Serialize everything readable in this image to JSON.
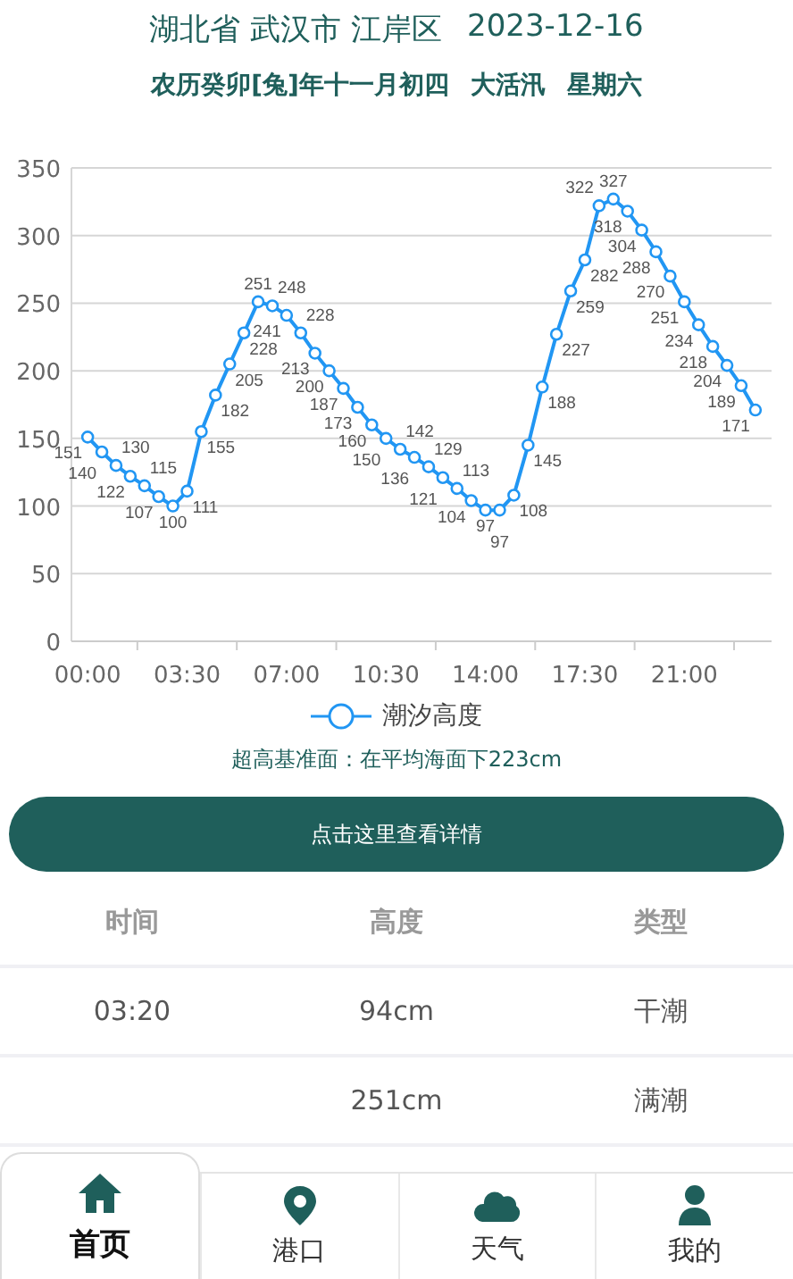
{
  "header": {
    "location": "湖北省 武汉市 江岸区",
    "date": "2023-12-16"
  },
  "lunar": [
    "农历癸卯[兔]年十一月初四",
    "大活汛",
    "星期六"
  ],
  "chart_data": {
    "type": "line",
    "x": [
      0,
      0.5,
      1,
      1.5,
      2,
      2.5,
      3,
      3.5,
      4,
      4.5,
      5,
      5.5,
      6,
      6.5,
      7,
      7.5,
      8,
      8.5,
      9,
      9.5,
      10,
      10.5,
      11,
      11.5,
      12,
      12.5,
      13,
      13.5,
      14,
      14.5,
      15,
      15.5,
      16,
      16.5,
      17,
      17.5,
      18,
      18.5,
      19,
      19.5,
      20,
      20.5,
      21,
      21.5,
      22,
      22.5,
      23,
      23.5
    ],
    "series": [
      {
        "name": "潮汐高度",
        "color": "#2196f3",
        "marker": "circle",
        "values": [
          151,
          140,
          130,
          122,
          115,
          107,
          100,
          111,
          155,
          182,
          205,
          228,
          251,
          248,
          241,
          228,
          213,
          200,
          187,
          173,
          160,
          150,
          142,
          136,
          129,
          121,
          113,
          104,
          97,
          97,
          108,
          145,
          188,
          227,
          259,
          282,
          322,
          327,
          318,
          304,
          288,
          270,
          251,
          234,
          218,
          204,
          189,
          171
        ]
      }
    ],
    "xlim": [
      -0.57,
      24.07
    ],
    "ylim": [
      0,
      350
    ],
    "yticks": [
      0,
      50,
      100,
      150,
      200,
      250,
      300,
      350
    ],
    "xticks": [
      {
        "value": 0,
        "label": "00:00"
      },
      {
        "value": 3.5,
        "label": "03:30"
      },
      {
        "value": 7,
        "label": "07:00"
      },
      {
        "value": 10.5,
        "label": "10:30"
      },
      {
        "value": 14,
        "label": "14:00"
      },
      {
        "value": 17.5,
        "label": "17:30"
      },
      {
        "value": 21,
        "label": "21:00"
      }
    ],
    "grid": true,
    "data_labels": true
  },
  "note": "超高基准面：在平均海面下223cm",
  "button": "点击这里查看详情",
  "table": {
    "columns": [
      "时间",
      "高度",
      "类型"
    ],
    "rows": [
      {
        "time": "03:20",
        "height": "94cm",
        "type": "干潮"
      },
      {
        "height": "251cm",
        "type": "满潮"
      }
    ]
  },
  "nav": [
    {
      "label": "首页",
      "selected": true
    },
    {
      "label": "港口",
      "selected": false
    },
    {
      "label": "天气",
      "selected": false
    },
    {
      "label": "我的",
      "selected": false
    }
  ]
}
